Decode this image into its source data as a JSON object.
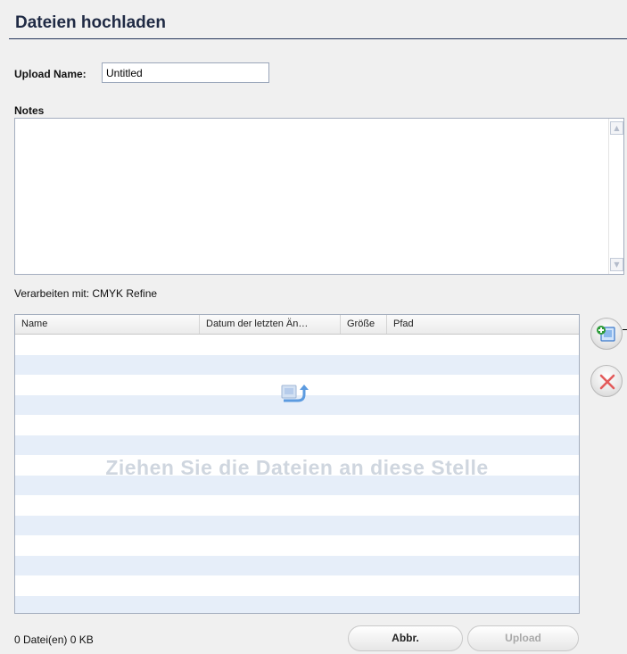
{
  "header": {
    "title": "Dateien hochladen"
  },
  "form": {
    "upload_name_label": "Upload Name:",
    "upload_name_value": "Untitled",
    "notes_label": "Notes",
    "notes_value": ""
  },
  "process": {
    "label": "Verarbeiten mit: CMYK Refine"
  },
  "file_table": {
    "columns": [
      "Name",
      "Datum der letzten Än…",
      "Größe",
      "Pfad"
    ],
    "rows": [],
    "drop_hint": "Ziehen Sie die Dateien an diese Stelle"
  },
  "side_buttons": {
    "add_icon": "add-file-icon",
    "remove_icon": "remove-x-icon"
  },
  "footer": {
    "status": "0 Datei(en) 0 KB",
    "cancel_label": "Abbr.",
    "upload_label": "Upload"
  },
  "colors": {
    "header_line": "#24345a",
    "row_stripe": "#e6eef9",
    "drop_hint": "#cfd6df",
    "remove_red": "#e35b5b",
    "disabled_text": "#a9a9a9"
  }
}
